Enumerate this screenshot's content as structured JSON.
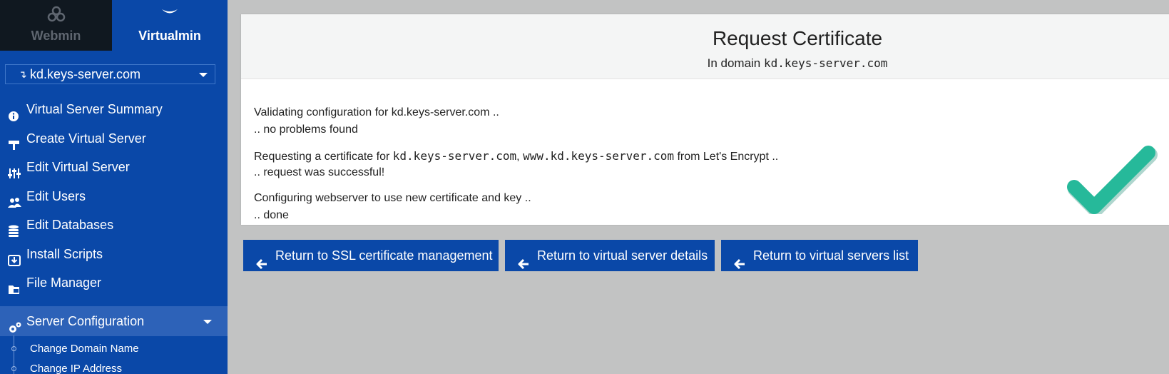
{
  "nav": {
    "webmin_tab": "Webmin",
    "virtualmin_tab": "Virtualmin"
  },
  "domain_select": {
    "value": "kd.keys-server.com",
    "prefix_glyph": "↴"
  },
  "menu": {
    "items": [
      {
        "label": "Virtual Server Summary",
        "icon": "info-circle-icon"
      },
      {
        "label": "Create Virtual Server",
        "icon": "sign-post-icon"
      },
      {
        "label": "Edit Virtual Server",
        "icon": "sliders-icon"
      },
      {
        "label": "Edit Users",
        "icon": "users-icon"
      },
      {
        "label": "Edit Databases",
        "icon": "database-icon"
      },
      {
        "label": "Install Scripts",
        "icon": "download-box-icon"
      },
      {
        "label": "File Manager",
        "icon": "folder-open-icon"
      },
      {
        "label": "Server Configuration",
        "icon": "gears-icon"
      }
    ],
    "subitems": [
      {
        "label": "Change Domain Name"
      },
      {
        "label": "Change IP Address"
      }
    ]
  },
  "page": {
    "title": "Request Certificate",
    "subtitle_prefix": "In domain",
    "subtitle_domain": "kd.keys-server.com"
  },
  "log": {
    "validating": "Validating configuration for kd.keys-server.com ..",
    "no_problems": ".. no problems found",
    "requesting_prefix": "Requesting a certificate for",
    "domain1": "kd.keys-server.com",
    "comma": ",",
    "domain2": "www.kd.keys-server.com",
    "requesting_suffix": "from Let's Encrypt ..",
    "request_success": ".. request was successful!",
    "configuring": "Configuring webserver to use new certificate and key ..",
    "done": ".. done"
  },
  "buttons": {
    "ssl": "Return to SSL certificate management",
    "details": "Return to virtual server details",
    "list": "Return to virtual servers list"
  },
  "colors": {
    "sidebar": "#0a48a8",
    "sidebar_active": "#2d62b8",
    "webmin_tab_bg": "#101820",
    "check": "#26b99a",
    "background": "#c2c3c3"
  }
}
